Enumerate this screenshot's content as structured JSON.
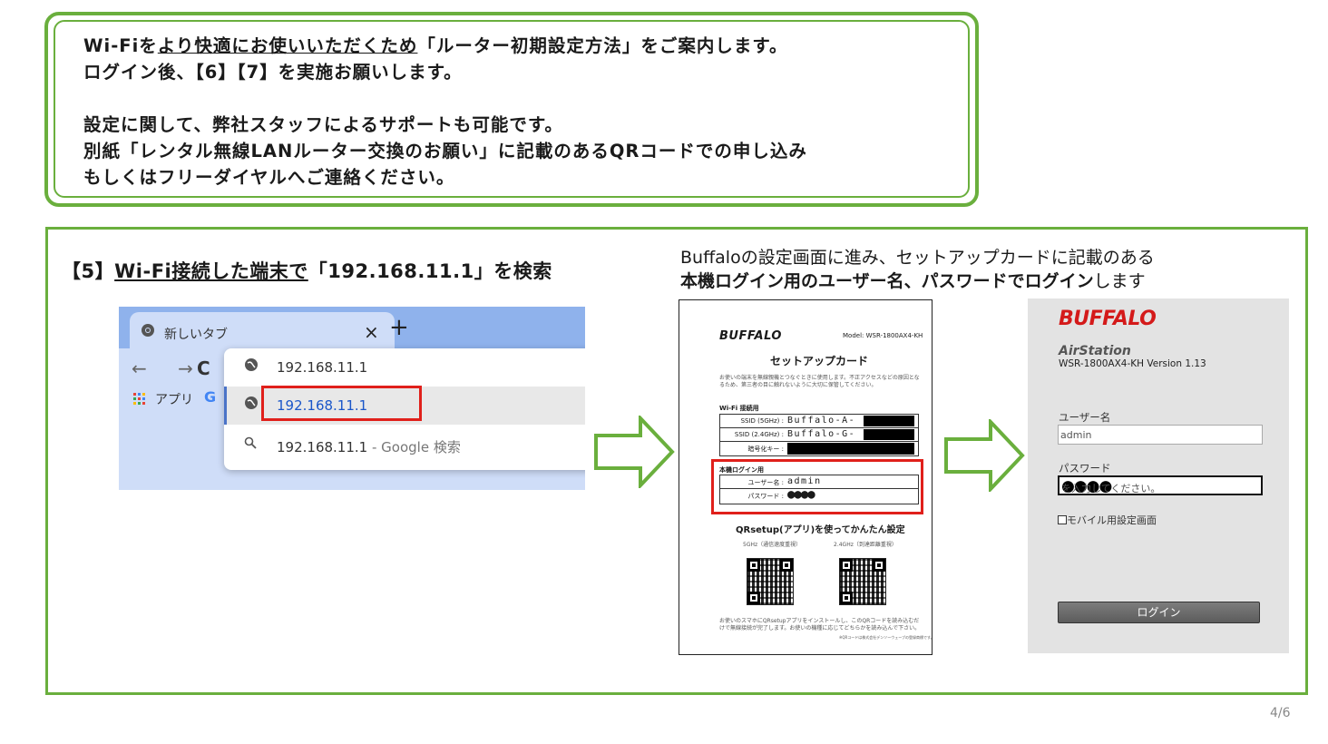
{
  "notice": {
    "line1_a": "Wi-Fiを",
    "line1_b": "より快適にお使いいただくため",
    "line1_c": "「ルーター初期設定方法」をご案内します。",
    "line2": "ログイン後、【6】【7】を実施お願いします。",
    "line3": "設定に関して、弊社スタッフによるサポートも可能です。",
    "line4": "別紙「レンタル無線LANルーター交換のお願い」に記載のあるQRコードでの申し込み",
    "line5": "もしくはフリーダイヤルへご連絡ください。"
  },
  "step": {
    "prefix": "【5】",
    "underlined": "Wi-Fi接続した端末で",
    "suffix": "「192.168.11.1」を検索"
  },
  "instruction": {
    "line1": "Buffaloの設定画面に進み、セットアップカードに記載のある",
    "line2_bold": "本機ログイン用のユーザー名、パスワードでログイン",
    "line2_rest": "します"
  },
  "browser": {
    "tab_title": "新しいタブ",
    "tab_close": "×",
    "new_tab": "+",
    "nav": "← →",
    "reload": "C",
    "bookmark_apps": "アプリ",
    "bookmark_g": "G",
    "suggestions": [
      {
        "text": "192.168.11.1",
        "extra": ""
      },
      {
        "text": "192.168.11.1",
        "extra": ""
      },
      {
        "text": "192.168.11.1",
        "extra": " - Google 検索"
      }
    ]
  },
  "card": {
    "logo": "BUFFALO",
    "model": "Model: WSR-1800AX4-KH",
    "title": "セットアップカード",
    "note": "お使いの端末を無線親機とつなぐときに使用します。不正アクセスなどの原因となるため、第三者の目に触れないように大切に保管してください。",
    "wifi_section": "Wi-Fi 接続用",
    "ssid5_label": "SSID (5GHz) :",
    "ssid5_value": "Buffalo-A-",
    "ssid24_label": "SSID (2.4GHz) :",
    "ssid24_value": "Buffalo-G-",
    "key_label": "暗号化キー :",
    "login_section": "本機ログイン用",
    "user_label": "ユーザー名 :",
    "user_value": "admin",
    "pass_label": "パスワード :",
    "pass_value": "●●●●",
    "qr_title": "QRsetup(アプリ)を使ってかんたん設定",
    "qr_5g": "5GHz（通信速度重視）",
    "qr_24g": "2.4GHz（到達距離重視）",
    "footer": "お使いのスマホにQRsetupアプリをインストールし、このQRコードを読み込むだけで無線接続が完了します。お使いの機種に応じてどちらかを読み込んで下さい。",
    "footer2": "※QRコードは株式会社デンソーウェーブの登録商標です。"
  },
  "login": {
    "logo": "BUFFALO",
    "product": "AirStation",
    "version": "WSR-1800AX4-KH Version 1.13",
    "user_label": "ユーザー名",
    "user_value": "admin",
    "pass_label": "パスワード",
    "pass_dots": "●●●●",
    "pass_placeholder": "を入力してください。",
    "mobile_checkbox": "モバイル用設定画面",
    "login_button": "ログイン"
  },
  "page": "4/6"
}
